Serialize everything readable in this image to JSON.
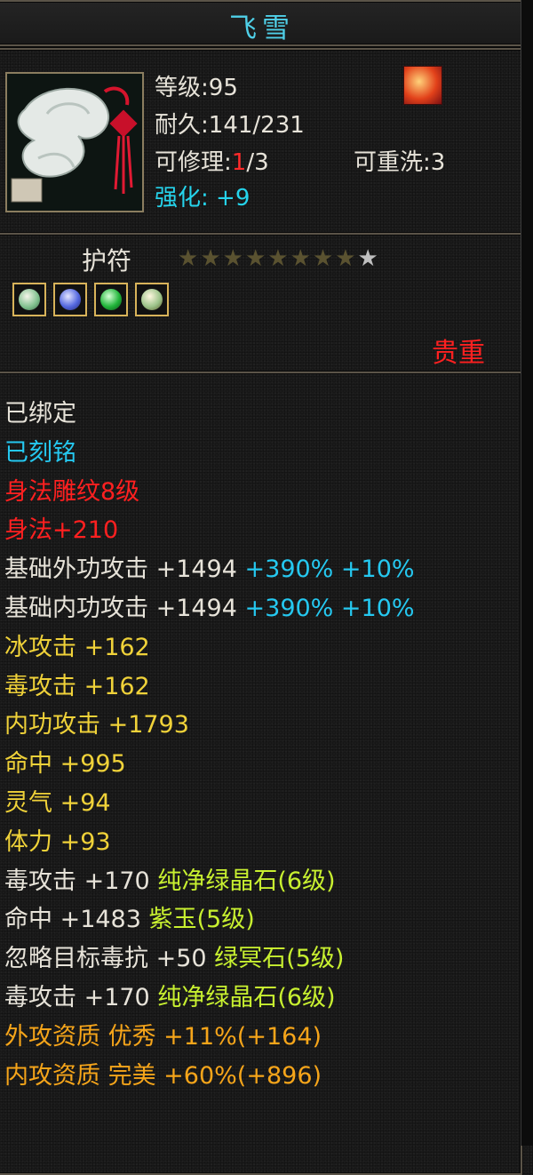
{
  "item": {
    "name": "飞雪",
    "level_label": "等级",
    "level": "95",
    "durability_label": "耐久",
    "durability": "141/231",
    "repair_label": "可修理",
    "repair_used": "1",
    "repair_total": "/3",
    "rewash_label": "可重洗",
    "rewash": "3",
    "enhance_label": "强化",
    "enhance": "+9",
    "type": "护符",
    "stars_filled": 8,
    "stars_total": 9,
    "rarity": "贵重"
  },
  "stats": [
    {
      "segments": [
        {
          "text": "已绑定",
          "color": "white"
        }
      ]
    },
    {
      "segments": [
        {
          "text": "已刻铭",
          "color": "cyan"
        }
      ]
    },
    {
      "segments": [
        {
          "text": "身法雕纹8级",
          "color": "red"
        }
      ]
    },
    {
      "segments": [
        {
          "text": "身法+210",
          "color": "red"
        }
      ]
    },
    {
      "segments": [
        {
          "text": "基础外功攻击 +1494 ",
          "color": "white"
        },
        {
          "text": "+390% +10%",
          "color": "cyan"
        }
      ]
    },
    {
      "segments": [
        {
          "text": "基础内功攻击 +1494 ",
          "color": "white"
        },
        {
          "text": "+390% +10%",
          "color": "cyan"
        }
      ]
    },
    {
      "segments": [
        {
          "text": "冰攻击 +162",
          "color": "yellow"
        }
      ]
    },
    {
      "segments": [
        {
          "text": "毒攻击 +162",
          "color": "yellow"
        }
      ]
    },
    {
      "segments": [
        {
          "text": "内功攻击 +1793",
          "color": "yellow"
        }
      ]
    },
    {
      "segments": [
        {
          "text": "命中 +995",
          "color": "yellow"
        }
      ]
    },
    {
      "segments": [
        {
          "text": "灵气 +94",
          "color": "yellow"
        }
      ]
    },
    {
      "segments": [
        {
          "text": "体力 +93",
          "color": "yellow"
        }
      ]
    },
    {
      "segments": [
        {
          "text": "毒攻击 +170 ",
          "color": "white"
        },
        {
          "text": "纯净绿晶石(6级)",
          "color": "lime"
        }
      ]
    },
    {
      "segments": [
        {
          "text": "命中 +1483 ",
          "color": "white"
        },
        {
          "text": "紫玉(5级)",
          "color": "lime"
        }
      ]
    },
    {
      "segments": [
        {
          "text": "忽略目标毒抗 +50 ",
          "color": "white"
        },
        {
          "text": "绿冥石(5级)",
          "color": "lime"
        }
      ]
    },
    {
      "segments": [
        {
          "text": "毒攻击 +170 ",
          "color": "white"
        },
        {
          "text": "纯净绿晶石(6级)",
          "color": "lime"
        }
      ]
    },
    {
      "segments": [
        {
          "text": "外攻资质  优秀 +11%(+164)",
          "color": "orange"
        }
      ]
    },
    {
      "segments": [
        {
          "text": "内攻资质  完美 +60%(+896)",
          "color": "orange"
        }
      ]
    }
  ],
  "colors": {
    "title": "#4fd0e8",
    "rarity": "#ff2020"
  },
  "icons": {
    "item_icon": "jade-pendant-icon",
    "fire_icon": "fire-element-icon",
    "gems": [
      "white-gem-icon",
      "purple-gem-icon",
      "green-gem-icon",
      "jade-gem-icon"
    ]
  }
}
